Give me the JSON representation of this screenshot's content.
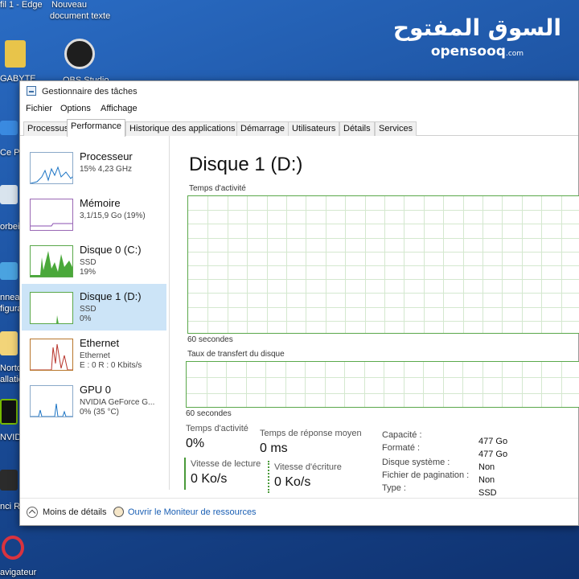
{
  "watermark": {
    "arabic": "السوق المفتوح",
    "latin": "opensooq",
    "suffix": ".com"
  },
  "desktop": {
    "labels": [
      "fil 1 - Edge",
      "Nouveau",
      "document texte",
      "GABYTE",
      "OBS Studio",
      "Ce Po",
      "orbei",
      "nneau",
      "figura",
      "Norto",
      "allation",
      "NVIDI",
      "nci Re",
      "avigateur"
    ]
  },
  "window": {
    "title": "Gestionnaire des tâches",
    "menu": [
      "Fichier",
      "Options",
      "Affichage"
    ],
    "tabs": [
      "Processus",
      "Performance",
      "Historique des applications",
      "Démarrage",
      "Utilisateurs",
      "Détails",
      "Services"
    ],
    "active_tab": "Performance"
  },
  "sidebar": {
    "items": [
      {
        "name": "Processeur",
        "sub1": "15% 4,23 GHz",
        "sub2": "",
        "selected": false
      },
      {
        "name": "Mémoire",
        "sub1": "3,1/15,9 Go (19%)",
        "sub2": "",
        "selected": false
      },
      {
        "name": "Disque 0 (C:)",
        "sub1": "SSD",
        "sub2": "19%",
        "selected": false
      },
      {
        "name": "Disque 1 (D:)",
        "sub1": "SSD",
        "sub2": "0%",
        "selected": true
      },
      {
        "name": "Ethernet",
        "sub1": "Ethernet",
        "sub2": "E : 0 R : 0 Kbits/s",
        "selected": false
      },
      {
        "name": "GPU 0",
        "sub1": "NVIDIA GeForce G...",
        "sub2": "0% (35 °C)",
        "selected": false
      }
    ]
  },
  "main": {
    "title": "Disque 1 (D:)",
    "activity_label": "Temps d'activité",
    "activity_span": "60 secondes",
    "transfer_label": "Taux de transfert du disque",
    "transfer_span": "60 secondes",
    "stats": {
      "activity_time_label": "Temps d'activité",
      "activity_time_value": "0%",
      "response_label": "Temps de réponse moyen",
      "response_value": "0 ms",
      "read_label": "Vitesse de lecture",
      "read_value": "0 Ko/s",
      "write_label": "Vitesse d'écriture",
      "write_value": "0 Ko/s"
    },
    "properties": [
      {
        "key": "Capacité :",
        "value": "477 Go"
      },
      {
        "key": "Formaté :",
        "value": "477 Go"
      },
      {
        "key": "Disque système :",
        "value": "Non"
      },
      {
        "key": "Fichier de pagination :",
        "value": "Non"
      },
      {
        "key": "Type :",
        "value": "SSD"
      }
    ]
  },
  "footer": {
    "fewer_details": "Moins de détails",
    "resource_monitor": "Ouvrir le Moniteur de ressources"
  }
}
